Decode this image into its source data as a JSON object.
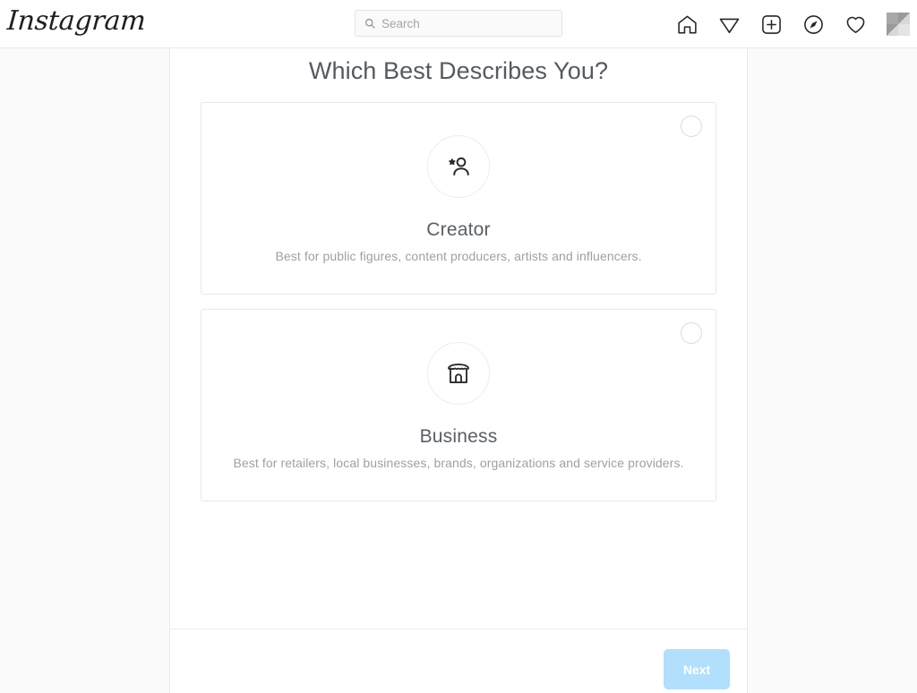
{
  "header": {
    "logo_text": "Instagram",
    "search": {
      "icon": "search-icon",
      "placeholder": "Search",
      "value": ""
    },
    "nav_items": [
      {
        "icon": "home-icon",
        "label": "Home"
      },
      {
        "icon": "direct-paper-plane-icon",
        "label": "Direct"
      },
      {
        "icon": "new-post-plus-icon",
        "label": "New Post"
      },
      {
        "icon": "explore-compass-icon",
        "label": "Explore"
      },
      {
        "icon": "activity-heart-icon",
        "label": "Activity"
      },
      {
        "icon": "profile-avatar",
        "label": "Profile"
      }
    ]
  },
  "main": {
    "title": "Which Best Describes You?",
    "options": [
      {
        "id": "creator",
        "icon": "creator-person-star-icon",
        "title": "Creator",
        "description": "Best for public figures, content producers, artists and influencers.",
        "selected": false
      },
      {
        "id": "business",
        "icon": "business-storefront-icon",
        "title": "Business",
        "description": "Best for retailers, local businesses, brands, organizations and service providers.",
        "selected": false
      }
    ]
  },
  "footer": {
    "next_label": "Next"
  },
  "colors": {
    "page_background": "#fafafa",
    "panel_background": "#ffffff",
    "border": "#e8e8e8",
    "title_text": "#555a60",
    "description_text": "#9ea0a3",
    "next_button_background": "#b2dffc",
    "next_button_text": "#ffffff"
  }
}
